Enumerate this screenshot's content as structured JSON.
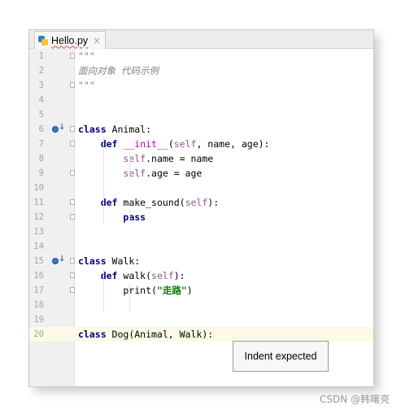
{
  "tab": {
    "title": "Hello.py",
    "close_glyph": "×"
  },
  "tooltip": {
    "text": "Indent expected"
  },
  "watermark": "CSDN @韩曙亮",
  "lines": [
    {
      "n": "1",
      "html": "<span class='doc'>\"\"\"</span>"
    },
    {
      "n": "2",
      "html": "<span class='doc'>面向对象 代码示例</span>"
    },
    {
      "n": "3",
      "html": "<span class='doc'>\"\"\"</span>"
    },
    {
      "n": "4",
      "html": ""
    },
    {
      "n": "5",
      "html": ""
    },
    {
      "n": "6",
      "html": "<span class='kw'>class</span> Animal:"
    },
    {
      "n": "7",
      "html": "    <span class='kw'>def</span> <span class='magic'>__init__</span>(<span class='self'>self</span>, name, age):"
    },
    {
      "n": "8",
      "html": "        <span class='self'>self</span>.name = name"
    },
    {
      "n": "9",
      "html": "        <span class='self'>self</span>.age = age"
    },
    {
      "n": "10",
      "html": ""
    },
    {
      "n": "11",
      "html": "    <span class='kw'>def</span> make_sound(<span class='self'>self</span>):"
    },
    {
      "n": "12",
      "html": "        <span class='kw'>pass</span>"
    },
    {
      "n": "13",
      "html": ""
    },
    {
      "n": "14",
      "html": ""
    },
    {
      "n": "15",
      "html": "<span class='kw'>class</span> Walk:"
    },
    {
      "n": "16",
      "html": "    <span class='kw'>def</span> walk(<span class='self'>self</span>):"
    },
    {
      "n": "17",
      "html": "        print(<span class='str'>\"走路\"</span>)"
    },
    {
      "n": "18",
      "html": ""
    },
    {
      "n": "19",
      "html": ""
    },
    {
      "n": "20",
      "html": "<span class='kw'>class</span> Dog(Animal, Walk):"
    }
  ],
  "current_line": "20",
  "gutter_markers": [
    "6",
    "15"
  ],
  "fold_markers": [
    "1",
    "3",
    "6",
    "7",
    "9",
    "11",
    "12",
    "15",
    "16",
    "17"
  ]
}
